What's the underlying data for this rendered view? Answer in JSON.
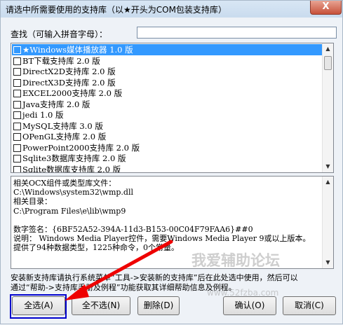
{
  "window": {
    "title": "请选中所需要使用的支持库（以★开头为COM包装支持库）",
    "close_label": "X"
  },
  "search": {
    "label": "查找（可输入拼音字母）：",
    "value": ""
  },
  "library_list": {
    "items": [
      {
        "label": "★Windows媒体播放器 1.0 版",
        "checked": false,
        "selected": true
      },
      {
        "label": "BT下载支持库 2.0 版",
        "checked": false,
        "selected": false
      },
      {
        "label": "DirectX2D支持库 2.0 版",
        "checked": false,
        "selected": false
      },
      {
        "label": "DirectX3D支持库 2.0 版",
        "checked": false,
        "selected": false
      },
      {
        "label": "EXCEL2000支持库 2.0 版",
        "checked": false,
        "selected": false
      },
      {
        "label": "Java支持库 2.0 版",
        "checked": false,
        "selected": false
      },
      {
        "label": "jedi 1.0 版",
        "checked": false,
        "selected": false
      },
      {
        "label": "MySQL支持库 3.0 版",
        "checked": false,
        "selected": false
      },
      {
        "label": "OPenGL支持库 2.0 版",
        "checked": false,
        "selected": false
      },
      {
        "label": "PowerPoint2000支持库 2.0 版",
        "checked": false,
        "selected": false
      },
      {
        "label": "Sqlite3数据库支持库 2.0 版",
        "checked": false,
        "selected": false
      },
      {
        "label": "Sqlite数据库支持库 2.0 版",
        "checked": false,
        "selected": false
      }
    ]
  },
  "info": {
    "lines": [
      "相关OCX组件或类型库文件：",
      "C:\\Windows\\system32\\wmp.dll",
      "相关目录：",
      "C:\\Program Files\\e\\lib\\wmp9",
      "",
      "数字签名：{6BF52A52-394A-11d3-B153-00C04F79FAA6}##0",
      "说明： Windows Media Player控件，需要Windows Media Player 9或以上版本。",
      "提供了94种数据类型，1225种命令，0个常量。"
    ]
  },
  "watermark": {
    "text": "我爱辅助论坛",
    "url": "www.52fzba.com"
  },
  "hint": {
    "line1": "安装新支持库请执行系统菜单“工具->安装新的支持库”后在此处选中使用，然后可以",
    "line2": "通过“帮助->支持库手册及例程”功能获取其详细帮助信息及例程。"
  },
  "buttons": {
    "select_all": "全选(A)",
    "select_none": "全不选(N)",
    "delete": "删除(D)",
    "ok": "确认(O)",
    "cancel": "取消(C)"
  },
  "colors": {
    "selection": "#3399ff",
    "highlight_box": "#0000cc",
    "arrow": "#ee0000"
  }
}
